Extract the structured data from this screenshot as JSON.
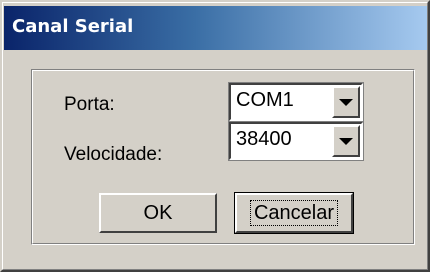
{
  "window": {
    "title": "Canal Serial"
  },
  "form": {
    "port_label": "Porta:",
    "port_value": "COM1",
    "speed_label": "Velocidade:",
    "speed_value": "38400"
  },
  "buttons": {
    "ok_label": "OK",
    "cancel_label": "Cancelar"
  },
  "icons": {
    "dropdown": "chevron-down-icon"
  },
  "colors": {
    "title_start": "#0a246a",
    "title_end": "#a6caf0",
    "face": "#d4d0c8"
  }
}
